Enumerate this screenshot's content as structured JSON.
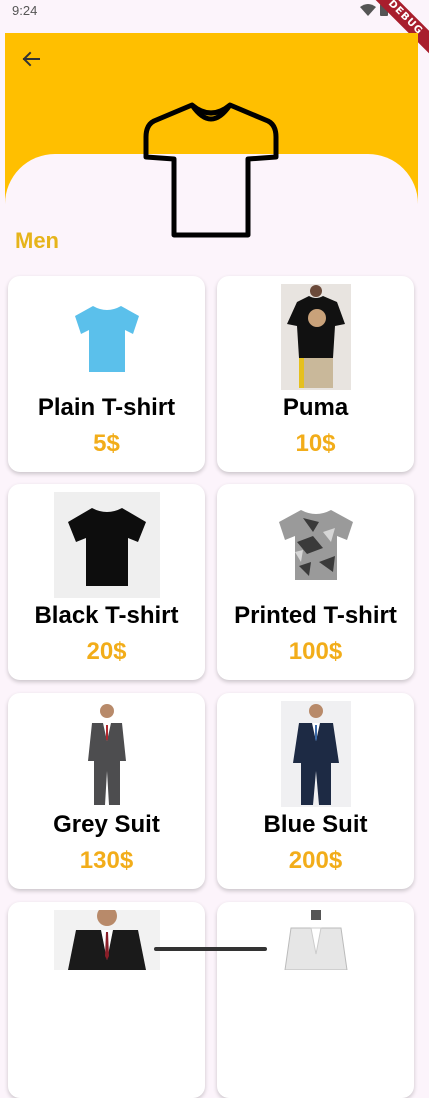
{
  "status_bar": {
    "time": "9:24",
    "debug_label": "DEBUG"
  },
  "header": {
    "back_icon": "arrow-left-icon",
    "hero_icon": "t-shirt-outline-icon",
    "accent": "#ffbf00"
  },
  "section": {
    "title": "Men"
  },
  "products": [
    {
      "name": "Plain T-shirt",
      "price": "5$",
      "image": "light-blue-tshirt"
    },
    {
      "name": "Puma",
      "price": "10$",
      "image": "black-printed-tshirt-model"
    },
    {
      "name": "Black T-shirt",
      "price": "20$",
      "image": "black-tshirt"
    },
    {
      "name": "Printed T-shirt",
      "price": "100$",
      "image": "camo-tshirt"
    },
    {
      "name": "Grey Suit",
      "price": "130$",
      "image": "grey-suit-model"
    },
    {
      "name": "Blue Suit",
      "price": "200$",
      "image": "navy-suit-model"
    },
    {
      "image": "dark-suit-model"
    },
    {
      "image": "white-suit-mannequin"
    }
  ],
  "colors": {
    "price": "#f2ad1a",
    "section_title": "#e6b41b",
    "background": "#fcf4fb"
  }
}
